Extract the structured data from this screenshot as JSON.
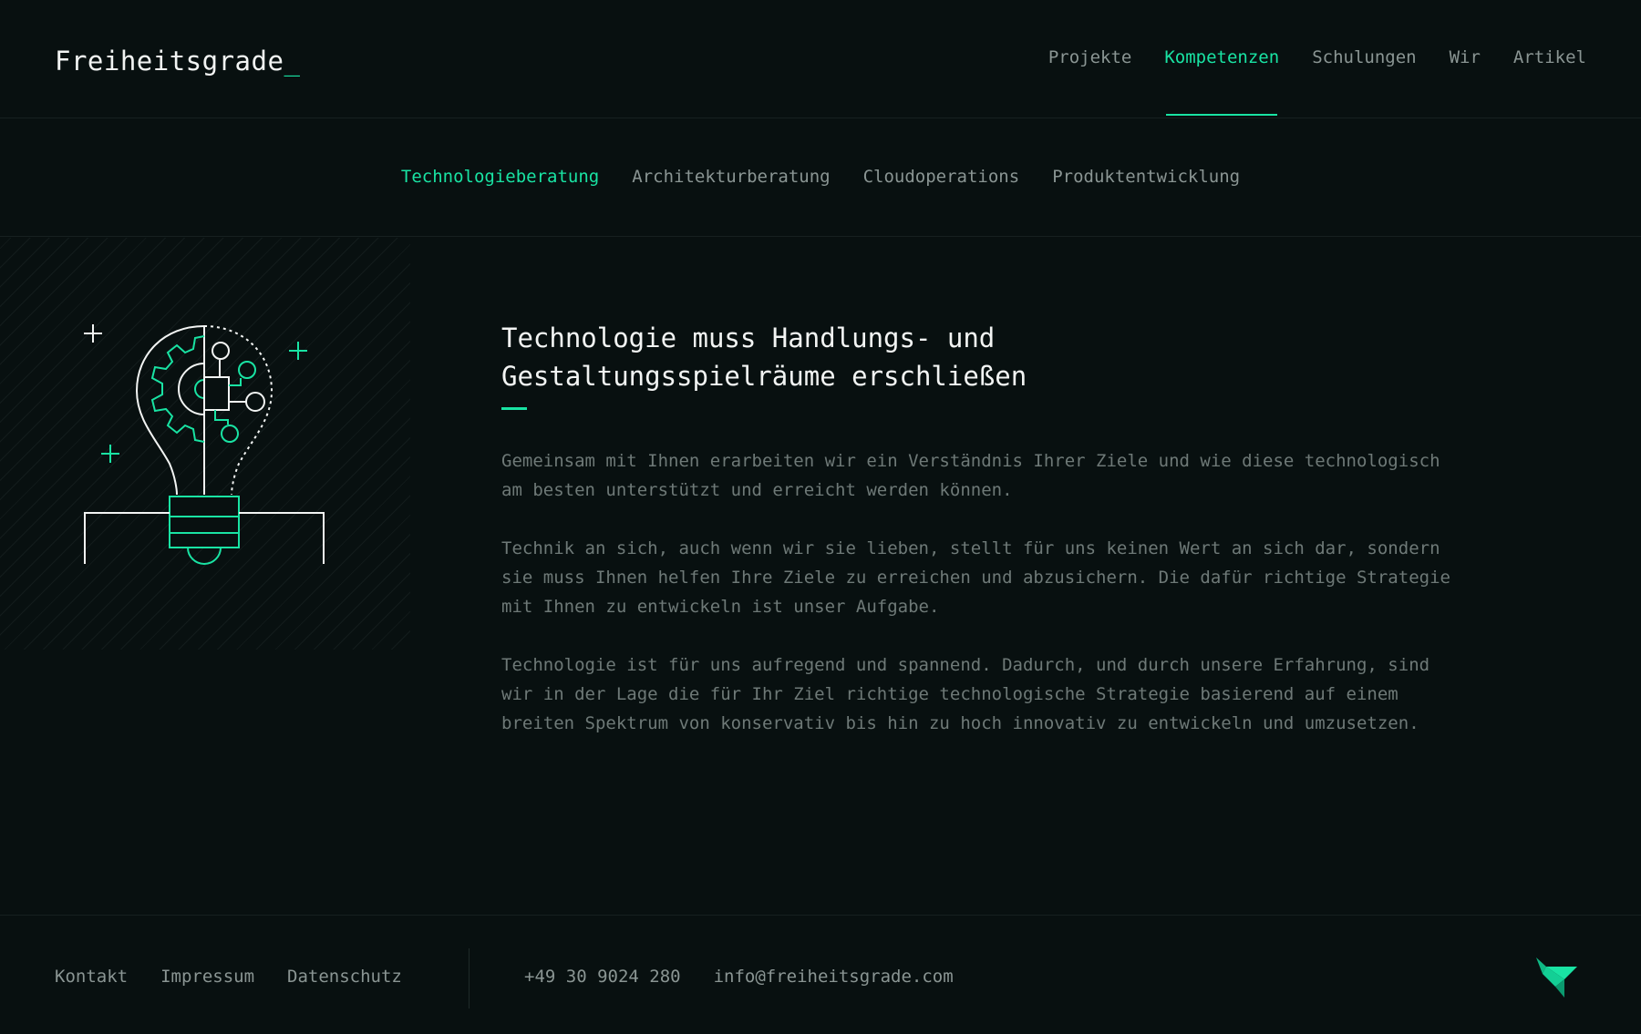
{
  "brand": {
    "name": "Freiheitsgrade",
    "cursor": "_",
    "accent_color": "#19e3a3"
  },
  "main_nav": {
    "items": [
      {
        "label": "Projekte"
      },
      {
        "label": "Kompetenzen",
        "active": true
      },
      {
        "label": "Schulungen"
      },
      {
        "label": "Wir"
      },
      {
        "label": "Artikel"
      }
    ]
  },
  "sub_nav": {
    "items": [
      {
        "label": "Technologieberatung",
        "active": true
      },
      {
        "label": "Architekturberatung"
      },
      {
        "label": "Cloudoperations"
      },
      {
        "label": "Produktentwicklung"
      }
    ]
  },
  "illustration": {
    "icon": "lightbulb-circuit-icon"
  },
  "main": {
    "headline_line1": "Technologie muss Handlungs- und",
    "headline_line2": "Gestaltungsspielräume erschließen",
    "paragraphs": [
      "Gemeinsam mit Ihnen erarbeiten wir ein Verständnis Ihrer Ziele und wie diese technologisch\nam besten unterstützt und erreicht werden können.",
      "Technik an sich, auch wenn wir sie lieben, stellt für uns keinen Wert an sich dar, sondern\nsie muss Ihnen helfen Ihre Ziele zu erreichen und abzusichern. Die dafür richtige Strategie\nmit Ihnen zu entwickeln ist unser Aufgabe.",
      "Technologie ist für uns aufregend und spannend. Dadurch, und durch unsere Erfahrung, sind\nwir in der Lage die für Ihr Ziel richtige technologische Strategie basierend auf einem\nbreiten Spektrum von konservativ bis hin zu hoch innovativ zu entwickeln und umzusetzen."
    ]
  },
  "footer": {
    "links": [
      {
        "label": "Kontakt"
      },
      {
        "label": "Impressum"
      },
      {
        "label": "Datenschutz"
      }
    ],
    "phone": "+49 30 9024 280",
    "email": "info@freiheitsgrade.com",
    "logo_icon": "bird-logo-icon"
  }
}
